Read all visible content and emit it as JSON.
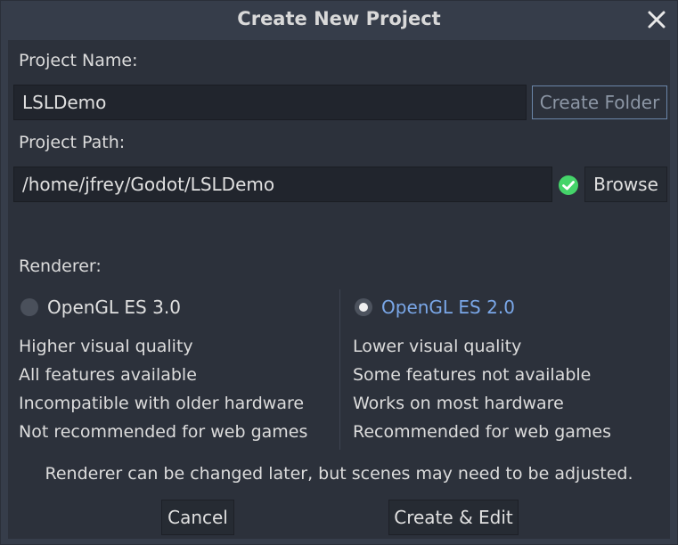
{
  "dialog": {
    "title": "Create New Project",
    "close_icon": "close-icon"
  },
  "project_name": {
    "label": "Project Name:",
    "value": "LSLDemo",
    "create_folder_label": "Create Folder"
  },
  "project_path": {
    "label": "Project Path:",
    "value": "/home/jfrey/Godot/LSLDemo",
    "status_icon": "check-circle-icon",
    "browse_label": "Browse"
  },
  "renderer": {
    "label": "Renderer:",
    "options": [
      {
        "label": "OpenGL ES 3.0",
        "selected": false,
        "features": [
          "Higher visual quality",
          "All features available",
          "Incompatible with older hardware",
          "Not recommended for web games"
        ]
      },
      {
        "label": "OpenGL ES 2.0",
        "selected": true,
        "features": [
          "Lower visual quality",
          "Some features not available",
          "Works on most hardware",
          "Recommended for web games"
        ]
      }
    ],
    "note": "Renderer can be changed later, but scenes may need to be adjusted."
  },
  "footer": {
    "cancel_label": "Cancel",
    "create_label": "Create & Edit"
  },
  "colors": {
    "accent": "#7aa7e8",
    "success": "#45d46a",
    "background": "#2c313b"
  }
}
